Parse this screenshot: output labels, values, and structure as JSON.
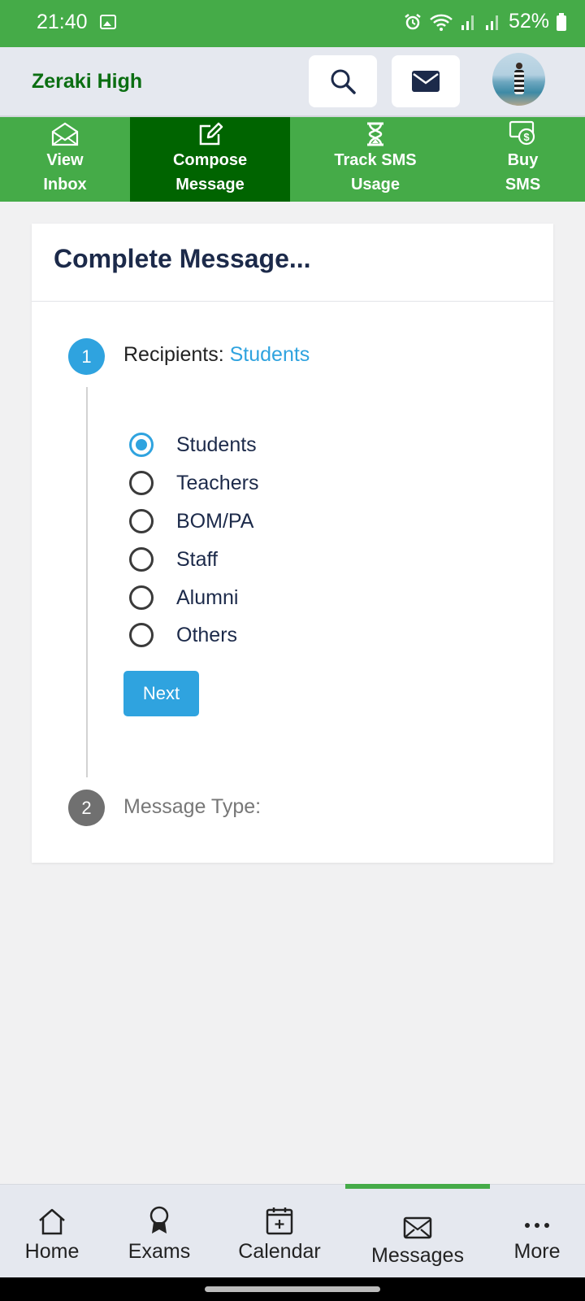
{
  "status_bar": {
    "time": "21:40",
    "battery": "52%"
  },
  "header": {
    "school_name": "Zeraki High"
  },
  "tabs": [
    {
      "label": "View\nInbox",
      "icon": "open-envelope-icon"
    },
    {
      "label": "Compose\nMessage",
      "icon": "edit-icon",
      "active": true
    },
    {
      "label": "Track SMS\nUsage",
      "icon": "hourglass-icon"
    },
    {
      "label": "Buy\nSMS",
      "icon": "money-icon"
    }
  ],
  "card": {
    "title": "Complete Message...",
    "step1": {
      "number": "1",
      "title": "Recipients: ",
      "value": "Students"
    },
    "step2": {
      "number": "2",
      "title": "Message Type:"
    },
    "options": [
      "Students",
      "Teachers",
      "BOM/PA",
      "Staff",
      "Alumni",
      "Others"
    ],
    "selected": "Students",
    "next_label": "Next"
  },
  "bottom_nav": [
    {
      "label": "Home",
      "icon": "home-icon"
    },
    {
      "label": "Exams",
      "icon": "award-icon"
    },
    {
      "label": "Calendar",
      "icon": "calendar-icon"
    },
    {
      "label": "Messages",
      "icon": "envelope-icon",
      "active": true
    },
    {
      "label": "More",
      "icon": "more-icon"
    }
  ],
  "colors": {
    "brand_green": "#45ab48",
    "dark_green": "#006400",
    "accent_blue": "#2fa3df",
    "title_navy": "#1c2a4a"
  }
}
